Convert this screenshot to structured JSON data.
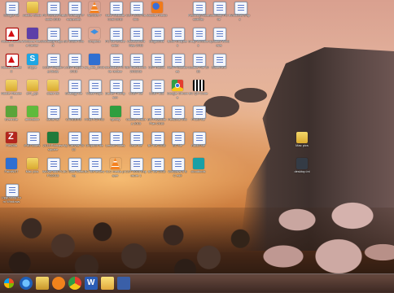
{
  "desktop": {
    "icons": [
      {
        "col": 0,
        "row": 0,
        "type": "doc",
        "label": "Google file"
      },
      {
        "col": 1,
        "row": 0,
        "type": "folder",
        "label": "Adobe Stock"
      },
      {
        "col": 2,
        "row": 0,
        "type": "doc",
        "label": "PC Review Results 2015"
      },
      {
        "col": 3,
        "row": 0,
        "type": "doc",
        "label": "BC Strategy Prospectus"
      },
      {
        "col": 4,
        "row": 0,
        "type": "vlc",
        "label": "NEXUS 7"
      },
      {
        "col": 5,
        "row": 0,
        "type": "doc",
        "label": "New Website Cost 2015"
      },
      {
        "col": 6,
        "row": 0,
        "type": "doc",
        "label": "CST 2015 Rubric"
      },
      {
        "col": 7,
        "row": 0,
        "type": "firefox",
        "label": "Mozilla Firefox"
      },
      {
        "col": 9,
        "row": 0,
        "type": "doc",
        "label": "Planning Accessibility"
      },
      {
        "col": 10,
        "row": 0,
        "type": "doc",
        "label": "Boundary PC file"
      },
      {
        "col": 11,
        "row": 0,
        "type": "doc",
        "label": "Windows 8 tips"
      },
      {
        "col": 0,
        "row": 1,
        "type": "pdf",
        "label": "Adobe Acrobat X"
      },
      {
        "col": 1,
        "row": 1,
        "type": "purple",
        "label": "Windows Media Center"
      },
      {
        "col": 2,
        "row": 1,
        "type": "doc",
        "label": "Strategy Layout"
      },
      {
        "col": 3,
        "row": 1,
        "type": "doc",
        "label": "BC Exam Info"
      },
      {
        "col": 4,
        "row": 1,
        "type": "dropbox",
        "label": "Dropbox"
      },
      {
        "col": 5,
        "row": 1,
        "type": "doc",
        "label": "PC file review letter"
      },
      {
        "col": 6,
        "row": 1,
        "type": "doc",
        "label": "Assessment May 2015"
      },
      {
        "col": 7,
        "row": 1,
        "type": "doc",
        "label": "blogbooks"
      },
      {
        "col": 8,
        "row": 1,
        "type": "doc",
        "label": "Book Chapters"
      },
      {
        "col": 9,
        "row": 1,
        "type": "doc",
        "label": "Snap Windows"
      },
      {
        "col": 10,
        "row": 1,
        "type": "doc",
        "label": "Updates Windows"
      },
      {
        "col": 0,
        "row": 2,
        "type": "pdf",
        "label": "Adobe Reader X"
      },
      {
        "col": 1,
        "row": 2,
        "type": "skype",
        "label": "Skype"
      },
      {
        "col": 2,
        "row": 2,
        "type": "doc",
        "label": "LGBT Wapping Study"
      },
      {
        "col": 3,
        "row": 2,
        "type": "doc",
        "label": "LGBT Report 2015"
      },
      {
        "col": 4,
        "row": 2,
        "type": "blue",
        "label": "sw_dtls_2015"
      },
      {
        "col": 5,
        "row": 2,
        "type": "doc",
        "label": "Boundary PC file review"
      },
      {
        "col": 6,
        "row": 2,
        "type": "doc",
        "label": "BC Handbook 2015/16"
      },
      {
        "col": 7,
        "row": 2,
        "type": "doc",
        "label": "CST Rubric"
      },
      {
        "col": 8,
        "row": 2,
        "type": "doc",
        "label": "New Procedures"
      },
      {
        "col": 9,
        "row": 2,
        "type": "doc",
        "label": "Course File 2015"
      },
      {
        "col": 10,
        "row": 2,
        "type": "doc",
        "label": "Statement"
      },
      {
        "col": 0,
        "row": 3,
        "type": "folder",
        "label": "Adobe Reader X"
      },
      {
        "col": 1,
        "row": 3,
        "type": "folder",
        "label": "ch4_ppt"
      },
      {
        "col": 2,
        "row": 3,
        "type": "folder",
        "label": "class list"
      },
      {
        "col": 3,
        "row": 3,
        "type": "doc",
        "label": "Strategy file"
      },
      {
        "col": 4,
        "row": 3,
        "type": "doc",
        "label": "Video Clips"
      },
      {
        "col": 5,
        "row": 3,
        "type": "doc",
        "label": "Daniel Thompson"
      },
      {
        "col": 6,
        "row": 3,
        "type": "doc",
        "label": "LGBT file"
      },
      {
        "col": 7,
        "row": 3,
        "type": "doc",
        "label": "LGBT doc"
      },
      {
        "col": 8,
        "row": 3,
        "type": "chrome",
        "label": "Google Chrome"
      },
      {
        "col": 9,
        "row": 3,
        "type": "qr",
        "label": "BC QR Code"
      },
      {
        "col": 0,
        "row": 4,
        "type": "evernote",
        "label": "Evernote"
      },
      {
        "col": 1,
        "row": 4,
        "type": "green2",
        "label": "animation"
      },
      {
        "col": 2,
        "row": 4,
        "type": "doc",
        "label": "cards list"
      },
      {
        "col": 3,
        "row": 4,
        "type": "doc",
        "label": "CAREERS"
      },
      {
        "col": 4,
        "row": 4,
        "type": "doc",
        "label": "Final PCPRO"
      },
      {
        "col": 5,
        "row": 4,
        "type": "spotify",
        "label": "Spotify"
      },
      {
        "col": 6,
        "row": 4,
        "type": "doc",
        "label": "Outline History 2015"
      },
      {
        "col": 7,
        "row": 4,
        "type": "doc",
        "label": "BC Financial Plan 2015"
      },
      {
        "col": 8,
        "row": 4,
        "type": "doc",
        "label": "Personal Info"
      },
      {
        "col": 9,
        "row": 4,
        "type": "doc",
        "label": "Photo file"
      },
      {
        "col": 0,
        "row": 5,
        "type": "filezilla",
        "label": "FileZilla"
      },
      {
        "col": 1,
        "row": 5,
        "type": "doc",
        "label": "iPad codes"
      },
      {
        "col": 2,
        "row": 5,
        "type": "excel",
        "label": "2015 Podcast square"
      },
      {
        "col": 3,
        "row": 5,
        "type": "doc",
        "label": "My Canvas 2015"
      },
      {
        "col": 4,
        "row": 5,
        "type": "doc",
        "label": "Dropbox file"
      },
      {
        "col": 5,
        "row": 5,
        "type": "doc",
        "label": "Lesson notes"
      },
      {
        "col": 6,
        "row": 5,
        "type": "doc",
        "label": "Leon file"
      },
      {
        "col": 7,
        "row": 5,
        "type": "doc",
        "label": "BC file 2015"
      },
      {
        "col": 8,
        "row": 5,
        "type": "doc",
        "label": "BC file"
      },
      {
        "col": 9,
        "row": 5,
        "type": "doc",
        "label": "Radio file"
      },
      {
        "col": 14,
        "row": 5,
        "type": "folder",
        "label": "Mac pics"
      },
      {
        "col": 0,
        "row": 6,
        "type": "blue",
        "label": "PaintNET"
      },
      {
        "col": 1,
        "row": 6,
        "type": "folder",
        "label": "Mac pics"
      },
      {
        "col": 2,
        "row": 6,
        "type": "doc",
        "label": "iMovie and PC FG2015"
      },
      {
        "col": 3,
        "row": 6,
        "type": "doc",
        "label": "BC Staff Meeting"
      },
      {
        "col": 4,
        "row": 6,
        "type": "doc",
        "label": "BC file review"
      },
      {
        "col": 5,
        "row": 6,
        "type": "vlc",
        "label": "VLC media player"
      },
      {
        "col": 6,
        "row": 6,
        "type": "doc",
        "label": "CST 2015 Exposure 1"
      },
      {
        "col": 7,
        "row": 6,
        "type": "doc",
        "label": "BC file 2015"
      },
      {
        "col": 8,
        "row": 6,
        "type": "doc",
        "label": "Windows 8 BC edit"
      },
      {
        "col": 9,
        "row": 6,
        "type": "teal",
        "label": "cloudtools"
      },
      {
        "col": 14,
        "row": 6,
        "type": "dark",
        "label": "desktop.ini"
      },
      {
        "col": 0,
        "row": 7,
        "type": "doc",
        "label": "Upgrading from Windows"
      }
    ]
  },
  "taskbar": {
    "items": [
      {
        "name": "start-button"
      },
      {
        "name": "internet-explorer-icon"
      },
      {
        "name": "file-explorer-icon"
      },
      {
        "name": "media-player-icon"
      },
      {
        "name": "chrome-icon"
      },
      {
        "name": "word-icon"
      },
      {
        "name": "outlook-icon"
      },
      {
        "name": "app-icon"
      }
    ]
  }
}
